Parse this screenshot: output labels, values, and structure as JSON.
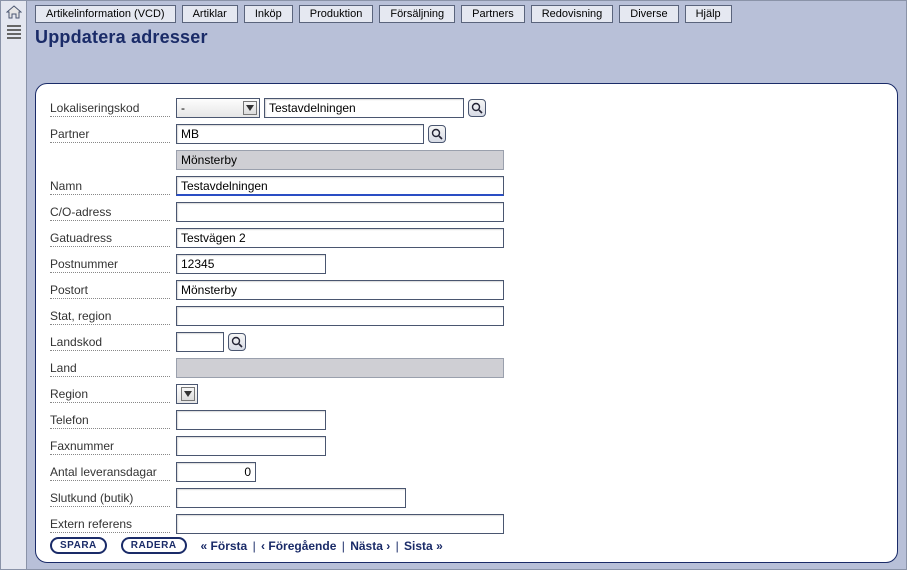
{
  "menu": {
    "items": [
      "Artikelinformation (VCD)",
      "Artiklar",
      "Inköp",
      "Produktion",
      "Försäljning",
      "Partners",
      "Redovisning",
      "Diverse",
      "Hjälp"
    ]
  },
  "page": {
    "title": "Uppdatera adresser"
  },
  "form": {
    "lokaliseringskod": {
      "label": "Lokaliseringskod",
      "select_value": "-",
      "lookup_value": "Testavdelningen"
    },
    "partner": {
      "label": "Partner",
      "value": "MB",
      "readonly_line": "Mönsterby"
    },
    "namn": {
      "label": "Namn",
      "value": "Testavdelningen"
    },
    "co_adress": {
      "label": "C/O-adress",
      "value": ""
    },
    "gatuadress": {
      "label": "Gatuadress",
      "value": "Testvägen 2"
    },
    "postnummer": {
      "label": "Postnummer",
      "value": "12345"
    },
    "postort": {
      "label": "Postort",
      "value": "Mönsterby"
    },
    "stat_region": {
      "label": "Stat, region",
      "value": ""
    },
    "landskod": {
      "label": "Landskod",
      "value": ""
    },
    "land": {
      "label": "Land",
      "value": ""
    },
    "region": {
      "label": "Region",
      "select_value": ""
    },
    "telefon": {
      "label": "Telefon",
      "value": ""
    },
    "faxnummer": {
      "label": "Faxnummer",
      "value": ""
    },
    "antal_leveransdagar": {
      "label": "Antal leveransdagar",
      "value": "0"
    },
    "slutkund": {
      "label": "Slutkund (butik)",
      "value": ""
    },
    "extern_referens": {
      "label": "Extern referens",
      "value": ""
    }
  },
  "footer": {
    "save": "SPARA",
    "delete": "RADERA",
    "first": "« Första",
    "prev": "‹ Föregående",
    "next": "Nästa ›",
    "last": "Sista »"
  }
}
